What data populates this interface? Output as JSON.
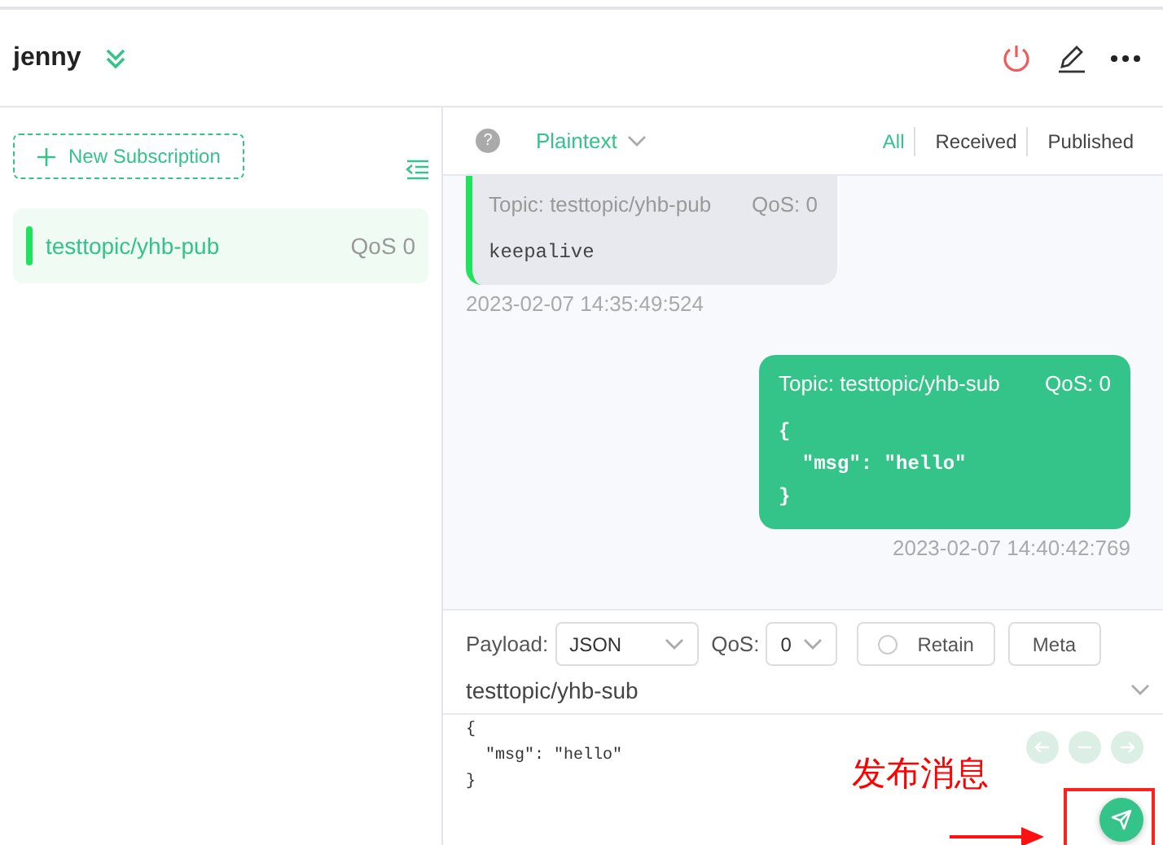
{
  "header": {
    "title": "jenny"
  },
  "sidebar": {
    "new_subscription": "New Subscription",
    "subscriptions": [
      {
        "topic": "testtopic/yhb-pub",
        "qos": "QoS 0",
        "color": "#1ee35c",
        "selected": true
      }
    ]
  },
  "toolbar": {
    "help": "?",
    "format": "Plaintext",
    "filters": [
      {
        "label": "All",
        "selected": true
      },
      {
        "label": "Received",
        "selected": false
      },
      {
        "label": "Published",
        "selected": false
      }
    ]
  },
  "messages": [
    {
      "kind": "received",
      "topic": "Topic: testtopic/yhb-pub",
      "qos": "QoS: 0",
      "payload": [
        "keepalive"
      ],
      "time": "2023-02-07 14:35:49:524"
    },
    {
      "kind": "sent",
      "topic": "Topic: testtopic/yhb-sub",
      "qos": "QoS: 0",
      "payload": [
        "{",
        "  \"msg\": \"hello\"",
        "}"
      ],
      "time": "2023-02-07 14:40:42:769"
    }
  ],
  "publish": {
    "payload_label": "Payload:",
    "payload_format": "JSON",
    "qos_label": "QoS:",
    "qos": "0",
    "retain": {
      "label": "Retain",
      "checked": false
    },
    "meta": "Meta",
    "topic": "testtopic/yhb-sub",
    "editor_lines": [
      "{",
      "  \"msg\": \"hello\"",
      "}"
    ]
  },
  "annotation": {
    "text": "发布消息"
  }
}
